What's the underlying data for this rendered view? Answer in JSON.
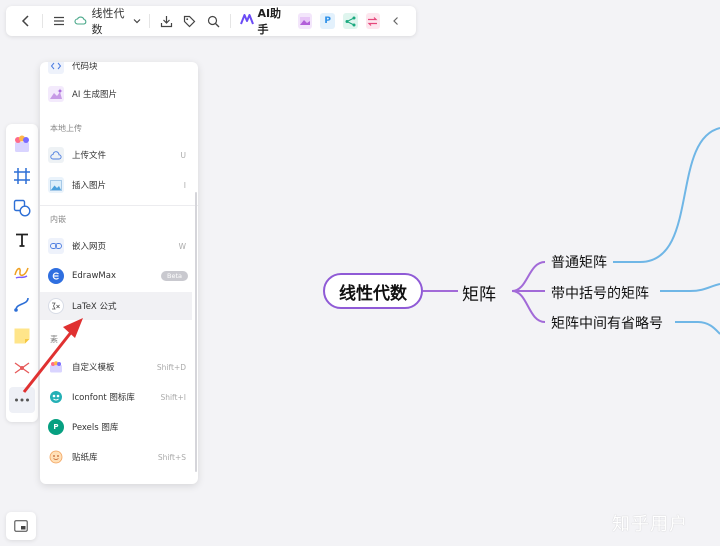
{
  "topbar": {
    "doc_title": "线性代数",
    "ai_label": "AI助手",
    "plugins": [
      {
        "name": "image-plugin",
        "glyph": "▦",
        "color": "#c36be0",
        "bg": "#f3e6fb"
      },
      {
        "name": "p-plugin",
        "glyph": "P",
        "color": "#2b8fe8",
        "bg": "#e3f1fc"
      },
      {
        "name": "share-plugin",
        "glyph": "⋖",
        "color": "#1aa97f",
        "bg": "#dff5ee"
      },
      {
        "name": "swap-plugin",
        "glyph": "⇄",
        "color": "#e5487b",
        "bg": "#fde6ee"
      }
    ]
  },
  "panel": {
    "top_items": [
      {
        "label": "代码块",
        "icon": "code-block-icon"
      },
      {
        "label": "AI 生成图片",
        "icon": "ai-image-icon"
      }
    ],
    "section_local": "本地上传",
    "local_items": [
      {
        "label": "上传文件",
        "shortcut": "U",
        "icon": "upload-file-icon"
      },
      {
        "label": "插入图片",
        "shortcut": "I",
        "icon": "insert-image-icon"
      }
    ],
    "section_embed": "内嵌",
    "embed_items": [
      {
        "label": "嵌入网页",
        "shortcut": "W",
        "icon": "embed-web-icon"
      },
      {
        "label": "EdrawMax",
        "badge": "Beta",
        "icon": "edrawmax-icon"
      },
      {
        "label": "LaTeX 公式",
        "icon": "latex-icon"
      }
    ],
    "section_resource": "素",
    "resource_items": [
      {
        "label": "自定义模板",
        "shortcut": "Shift+D",
        "icon": "template-icon"
      },
      {
        "label": "Iconfont 图标库",
        "shortcut": "Shift+I",
        "icon": "iconfont-icon"
      },
      {
        "label": "Pexels 图库",
        "icon": "pexels-icon"
      },
      {
        "label": "贴纸库",
        "shortcut": "Shift+S",
        "icon": "sticker-icon"
      }
    ]
  },
  "mindmap": {
    "root": "线性代数",
    "main": "矩阵",
    "subs": [
      "普通矩阵",
      "带中括号的矩阵",
      "矩阵中间有省略号"
    ],
    "colors": {
      "root_border": "#8f5ad6",
      "branch_purple": "#a26ad8",
      "branch_blue": "#6fb6e6"
    }
  },
  "watermark": "知乎用户",
  "colors": {
    "accent": "#6b4cf5",
    "annotation_arrow": "#e03131"
  }
}
